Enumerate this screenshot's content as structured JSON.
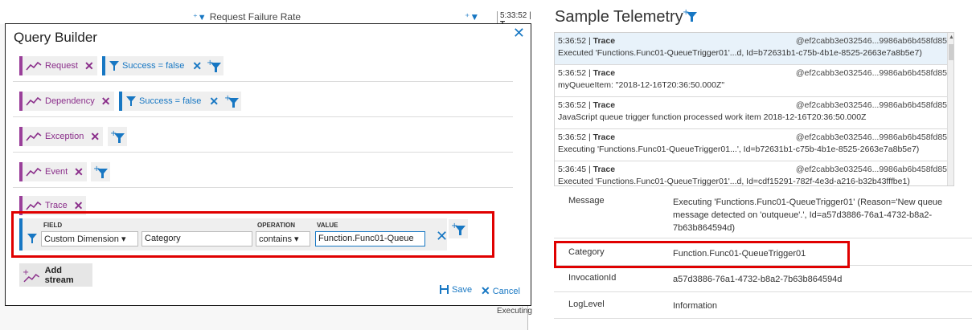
{
  "background": {
    "header_text": "Request Failure Rate",
    "time": "5:33:52",
    "time_suffix": "T",
    "bottom_text": "Executing"
  },
  "query_builder": {
    "title": "Query Builder",
    "close_glyph": "✕",
    "rows": [
      {
        "stream": "Request",
        "filter": "Success = false"
      },
      {
        "stream": "Dependency",
        "filter": "Success = false"
      },
      {
        "stream": "Exception"
      },
      {
        "stream": "Event"
      },
      {
        "stream": "Trace"
      }
    ],
    "filter_editor": {
      "field_label": "FIELD",
      "operation_label": "OPERATION",
      "value_label": "VALUE",
      "field_type": "Custom Dimension",
      "field_name": "Category",
      "operation": "contains",
      "value": "Function.Func01-Queue"
    },
    "add_stream_label": "Add stream",
    "save_label": "Save",
    "cancel_label": "Cancel"
  },
  "sample_telemetry": {
    "title": "Sample Telemetry",
    "items": [
      {
        "time": "5:36:52",
        "type": "Trace",
        "id": "@ef2cabb3e032546...9986ab6b458fd85",
        "message": "Executed 'Functions.Func01-QueueTrigger01'...d, Id=b72631b1-c75b-4b1e-8525-2663e7a8b5e7)"
      },
      {
        "time": "5:36:52",
        "type": "Trace",
        "id": "@ef2cabb3e032546...9986ab6b458fd85",
        "message": "myQueueItem: \"2018-12-16T20:36:50.000Z\""
      },
      {
        "time": "5:36:52",
        "type": "Trace",
        "id": "@ef2cabb3e032546...9986ab6b458fd85",
        "message": "JavaScript queue trigger function processed work item 2018-12-16T20:36:50.000Z"
      },
      {
        "time": "5:36:52",
        "type": "Trace",
        "id": "@ef2cabb3e032546...9986ab6b458fd85",
        "message": "Executing 'Functions.Func01-QueueTrigger01...', Id=b72631b1-c75b-4b1e-8525-2663e7a8b5e7)"
      },
      {
        "time": "5:36:45",
        "type": "Trace",
        "id": "@ef2cabb3e032546...9986ab6b458fd85",
        "message": "Executed 'Functions.Func01-QueueTrigger01'...d, Id=cdf15291-782f-4e3d-a216-b32b43fffbe1)"
      }
    ],
    "properties": [
      {
        "key": "Message",
        "value": "Executing 'Functions.Func01-QueueTrigger01' (Reason='New queue message detected on 'outqueue'.', Id=a57d3886-76a1-4732-b8a2-7b63b864594d)"
      },
      {
        "key": "Category",
        "value": "Function.Func01-QueueTrigger01"
      },
      {
        "key": "InvocationId",
        "value": "a57d3886-76a1-4732-b8a2-7b63b864594d"
      },
      {
        "key": "LogLevel",
        "value": "Information"
      }
    ]
  },
  "colors": {
    "accent_blue": "#1777c3",
    "stream_purple": "#9a3f9a",
    "highlight_red": "#e00000"
  },
  "icons": [
    "add-filter-icon",
    "filter-icon",
    "line-chart-icon",
    "close-icon",
    "save-icon",
    "cancel-icon",
    "add-stream-icon",
    "scroll-up-icon"
  ]
}
